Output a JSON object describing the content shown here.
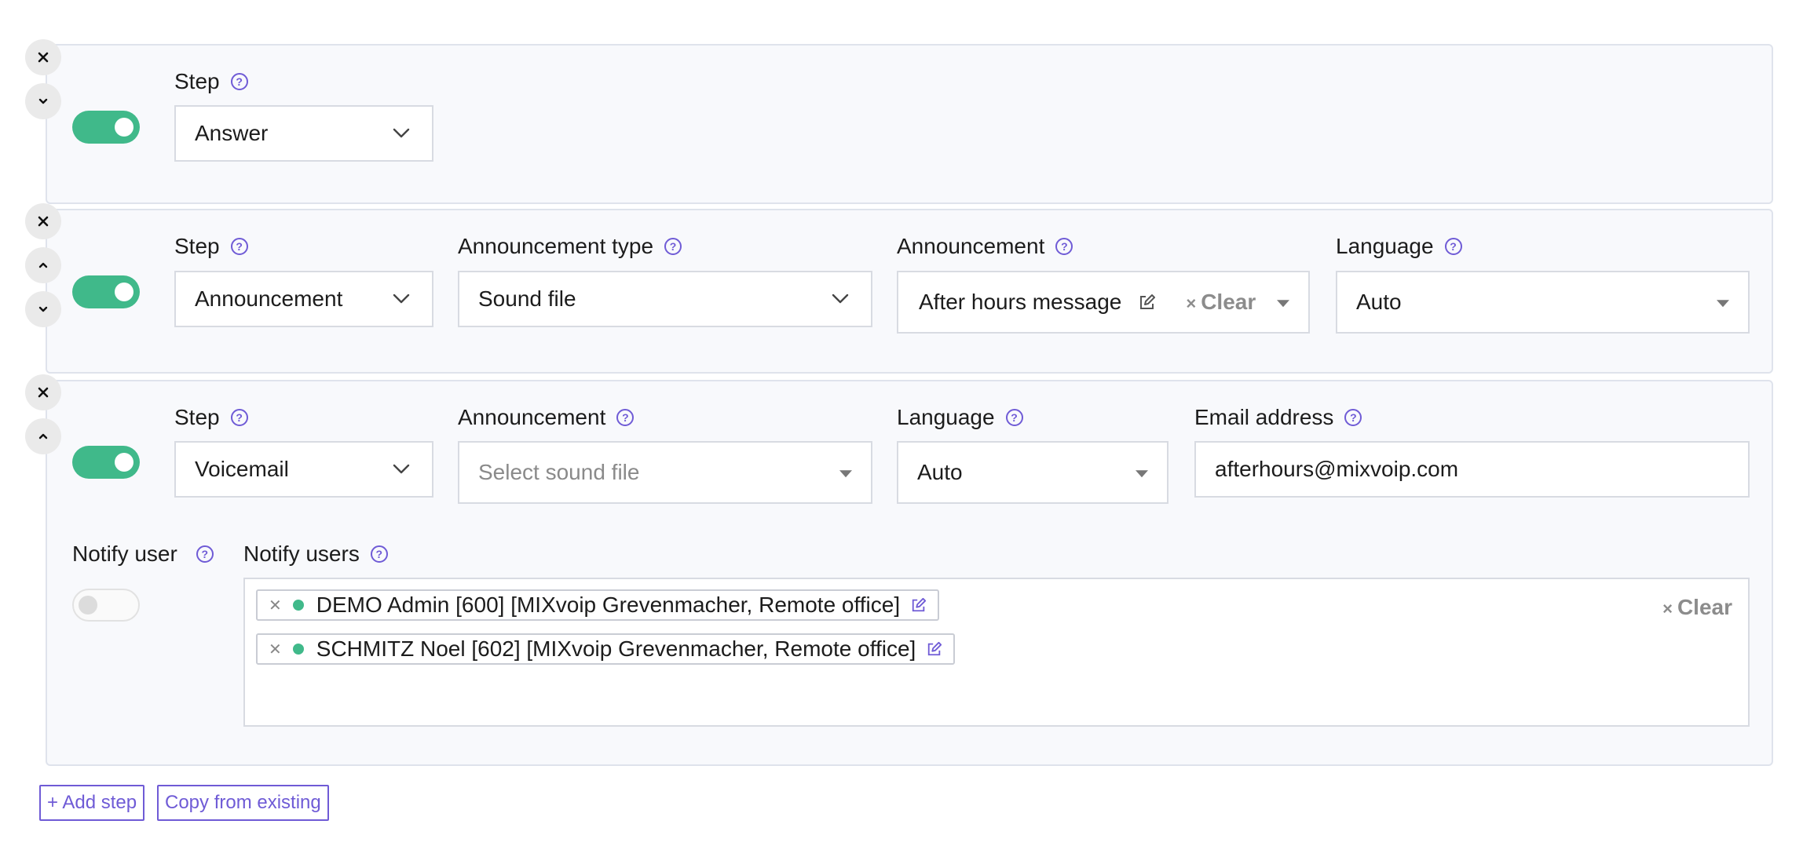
{
  "steps": [
    {
      "step_label": "Step",
      "step_value": "Answer"
    },
    {
      "step_label": "Step",
      "step_value": "Announcement",
      "announcement_type_label": "Announcement type",
      "announcement_type_value": "Sound file",
      "announcement_label": "Announcement",
      "announcement_value": "After hours message",
      "clear_label": "Clear",
      "language_label": "Language",
      "language_value": "Auto"
    },
    {
      "step_label": "Step",
      "step_value": "Voicemail",
      "announcement_label": "Announcement",
      "announcement_placeholder": "Select sound file",
      "language_label": "Language",
      "language_value": "Auto",
      "email_label": "Email address",
      "email_value": "afterhours@mixvoip.com",
      "notify_user_label": "Notify user",
      "notify_users_label": "Notify users",
      "notify_users": [
        "DEMO Admin [600] [MIXvoip Grevenmacher, Remote office]",
        "SCHMITZ Noel [602] [MIXvoip Grevenmacher, Remote office]"
      ],
      "clear_label": "Clear"
    }
  ],
  "footer": {
    "add_step_label": "+ Add step",
    "copy_label": "Copy from existing"
  },
  "icons": {
    "help": "?",
    "close": "×"
  },
  "colors": {
    "accent": "#6f5bd6",
    "toggle_on": "#40b98a"
  }
}
